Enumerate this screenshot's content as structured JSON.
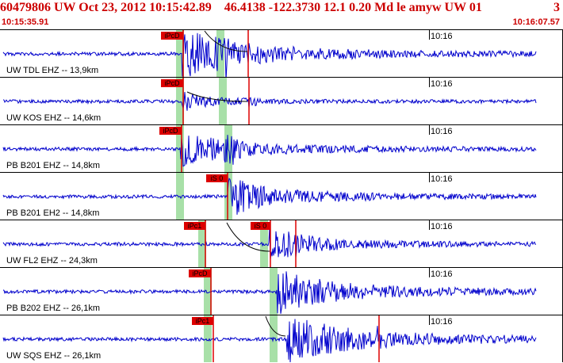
{
  "header": {
    "title": "60479806 UW Oct 23, 2012 10:15:42.89    46.4138 -122.3730 12.1 0.20 Md le amyw UW 01",
    "title_right": "3",
    "start_time": "10:15:35.91",
    "end_time": "10:16:07.57"
  },
  "colors": {
    "trace": "#0000cc",
    "pick_flag": "#dd0000",
    "pick_window": "#a8e0a8",
    "header_text": "#cc0000"
  },
  "traces": [
    {
      "label": "UW TDL EHZ -- 13,9km",
      "tick": "10:16",
      "picks": [
        {
          "label": "iPcD"
        }
      ]
    },
    {
      "label": "UW KOS EHZ -- 14,6km",
      "tick": "10:16",
      "picks": [
        {
          "label": "iPcD"
        }
      ]
    },
    {
      "label": "PB B201 EHZ -- 14,8km",
      "tick": "10:16",
      "picks": [
        {
          "label": "iPcD"
        }
      ]
    },
    {
      "label": "PB B201 EH2 -- 14,8km",
      "tick": "10:16",
      "picks": [
        {
          "label": "iS 0"
        }
      ]
    },
    {
      "label": "UW FL2 EHZ -- 24,3km",
      "tick": "10:16",
      "picks": [
        {
          "label": "iPc1"
        },
        {
          "label": "iS 0"
        }
      ]
    },
    {
      "label": "PB B202 EHZ -- 26,1km",
      "tick": "10:16",
      "picks": [
        {
          "label": "iPcD"
        }
      ]
    },
    {
      "label": "UW SQS EHZ -- 26,1km",
      "tick": "10:16",
      "picks": [
        {
          "label": "iPc1"
        }
      ]
    }
  ]
}
